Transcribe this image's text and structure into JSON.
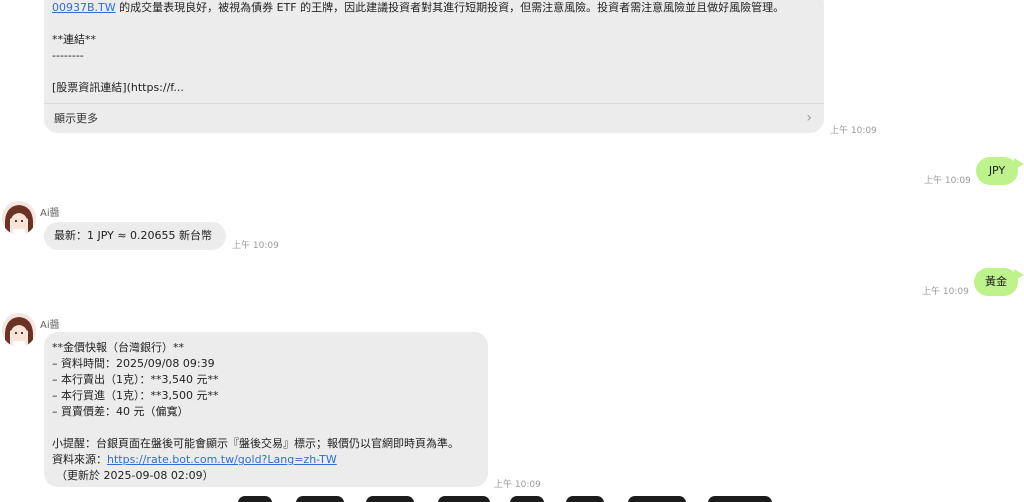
{
  "message1": {
    "link_text": "00937B.TW",
    "line1_rest": " 的成交量表現良好，被視為債券 ETF 的王牌，因此建議投資者對其進行短期投資，但需注意風險。投資者需注意風險並且做好風險管理。",
    "heading": "**連結**",
    "divider": "--------",
    "preview": "[股票資訊連結](https://f...",
    "show_more": "顯示更多",
    "time": "上午 10:09"
  },
  "user1": {
    "text": "JPY",
    "time": "上午 10:09"
  },
  "bot1": {
    "sender": "Ai醬",
    "text": "最新：1 JPY ≈ 0.20655 新台幣",
    "time": "上午 10:09"
  },
  "user2": {
    "text": "黃金",
    "time": "上午 10:09"
  },
  "bot2": {
    "sender": "Ai醬",
    "lines": [
      "**金價快報（台灣銀行）**",
      "– 資料時間：2025/09/08 09:39",
      "– 本行賣出（1克）：**3,540 元**",
      "– 本行買進（1克）：**3,500 元**",
      "– 買賣價差：40 元（偏寬）",
      "",
      "小提醒：台銀頁面在盤後可能會顯示『盤後交易』標示；報價仍以官網即時頁為準。"
    ],
    "source_label": "資料來源：",
    "source_url": "https://rate.bot.com.tw/gold?Lang=zh-TW",
    "updated": "（更新於 2025-09-08 02:09）",
    "time": "上午 10:09"
  },
  "icons": {
    "avatar": "anime-girl-avatar",
    "chevron": "chevron-right-icon"
  }
}
